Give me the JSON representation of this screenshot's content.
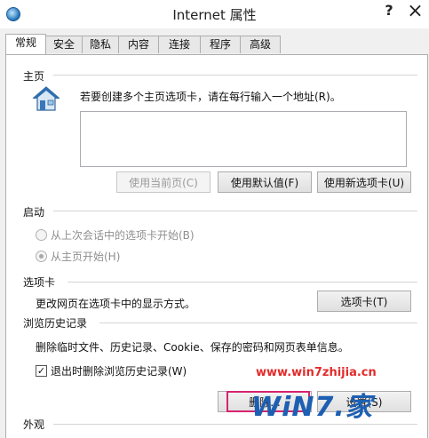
{
  "window": {
    "title": "Internet 属性",
    "help_glyph": "?",
    "close_glyph": "×"
  },
  "tabs": [
    {
      "label": "常规",
      "active": true
    },
    {
      "label": "安全"
    },
    {
      "label": "隐私"
    },
    {
      "label": "内容"
    },
    {
      "label": "连接"
    },
    {
      "label": "程序"
    },
    {
      "label": "高级"
    }
  ],
  "home": {
    "group_label": "主页",
    "instruction": "若要创建多个主页选项卡，请在每行输入一个地址(R)。",
    "address_value": "",
    "btn_use_current": "使用当前页(C)",
    "btn_use_default": "使用默认值(F)",
    "btn_use_new_tab": "使用新选项卡(U)"
  },
  "startup": {
    "group_label": "启动",
    "option_last_session": "从上次会话中的选项卡开始(B)",
    "option_home": "从主页开始(H)",
    "selected": "option_home"
  },
  "tabs_group": {
    "group_label": "选项卡",
    "description": "更改网页在选项卡中的显示方式。",
    "btn_tabs": "选项卡(T)"
  },
  "history": {
    "group_label": "浏览历史记录",
    "description": "删除临时文件、历史记录、Cookie、保存的密码和网页表单信息。",
    "checkbox_label": "退出时删除浏览历史记录(W)",
    "checkbox_checked": true,
    "btn_delete": "删除...",
    "btn_settings": "设置(S)"
  },
  "appearance": {
    "group_label": "外观"
  },
  "watermark": {
    "url": "www.win7zhijia.cn",
    "logo": "WiN7.家"
  },
  "colors": {
    "watermark_url": "#e32b2b",
    "watermark_logo": "#1d5fb2",
    "highlight_box": "#d6236f"
  }
}
